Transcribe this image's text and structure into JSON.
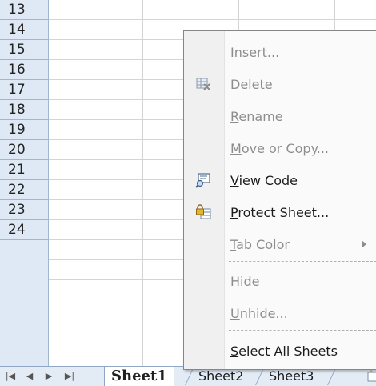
{
  "rows": [
    "13",
    "14",
    "15",
    "16",
    "17",
    "18",
    "19",
    "20",
    "21",
    "22",
    "23",
    "24"
  ],
  "tabs": {
    "nav": [
      "|◀",
      "◀",
      "▶",
      "▶|"
    ],
    "sheets": [
      "Sheet1",
      "Sheet2",
      "Sheet3"
    ],
    "active": "Sheet1",
    "insert_sheet_icon": "insert-worksheet-icon"
  },
  "context_menu": {
    "items": [
      {
        "pre": "",
        "accel": "I",
        "post": "nsert...",
        "enabled": false,
        "icon": ""
      },
      {
        "pre": "",
        "accel": "D",
        "post": "elete",
        "enabled": false,
        "icon": "delete-sheet-icon"
      },
      {
        "pre": "",
        "accel": "R",
        "post": "ename",
        "enabled": false,
        "icon": ""
      },
      {
        "pre": "",
        "accel": "M",
        "post": "ove or Copy...",
        "enabled": false,
        "icon": ""
      },
      {
        "pre": "",
        "accel": "V",
        "post": "iew Code",
        "enabled": true,
        "icon": "view-code-icon"
      },
      {
        "pre": "",
        "accel": "P",
        "post": "rotect Sheet...",
        "enabled": true,
        "icon": "protect-sheet-icon"
      },
      {
        "pre": "",
        "accel": "T",
        "post": "ab Color",
        "enabled": false,
        "icon": "",
        "submenu": true
      },
      {
        "pre": "",
        "accel": "H",
        "post": "ide",
        "enabled": false,
        "icon": ""
      },
      {
        "pre": "",
        "accel": "U",
        "post": "nhide...",
        "enabled": false,
        "icon": ""
      },
      {
        "pre": "",
        "accel": "S",
        "post": "elect All Sheets",
        "enabled": true,
        "icon": ""
      }
    ]
  },
  "colors": {
    "header_bg": "#dfe8f5",
    "disabled_text": "#8d8d8d",
    "enabled_text": "#1c1c1c"
  }
}
